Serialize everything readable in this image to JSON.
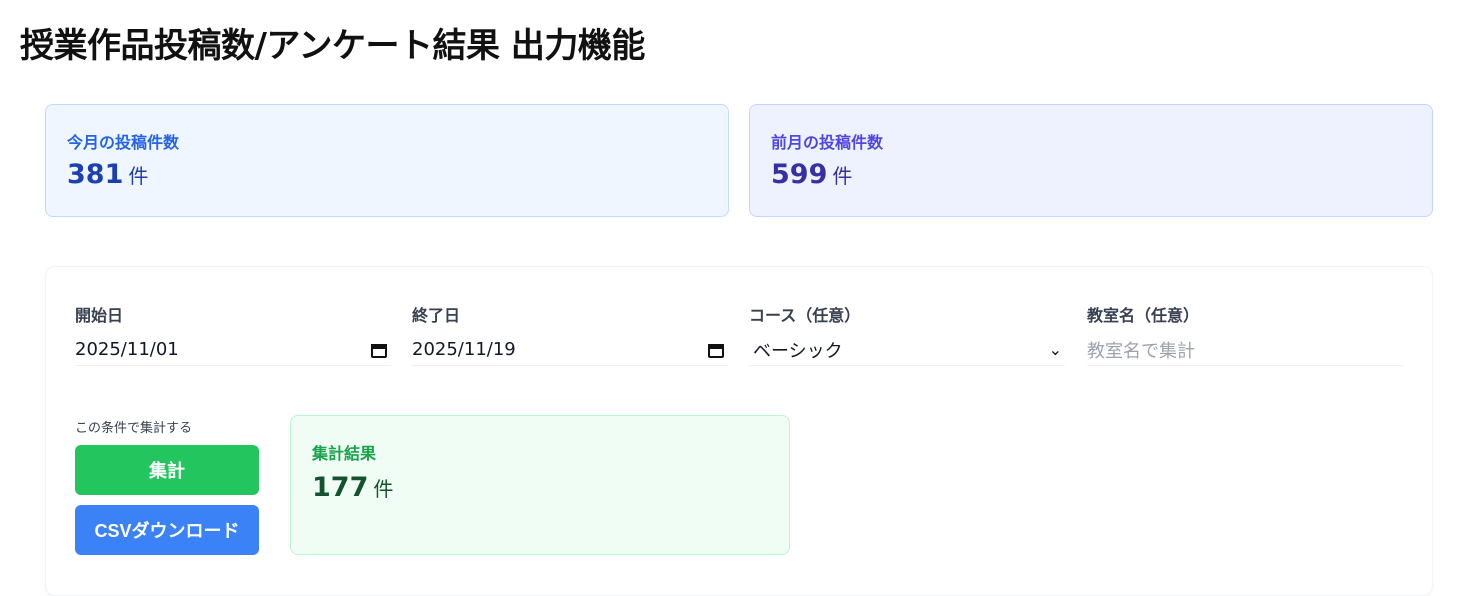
{
  "page": {
    "title": "授業作品投稿数/アンケート結果 出力機能"
  },
  "stats": {
    "current": {
      "label": "今月の投稿件数",
      "value": "381",
      "unit": "件"
    },
    "previous": {
      "label": "前月の投稿件数",
      "value": "599",
      "unit": "件"
    }
  },
  "filters": {
    "start": {
      "label": "開始日",
      "value": "2025/11/01",
      "icon": "calendar-icon"
    },
    "end": {
      "label": "終了日",
      "value": "2025/11/19",
      "icon": "calendar-icon"
    },
    "course": {
      "label": "コース（任意）",
      "value": "ベーシック",
      "icon": "chevron-down-icon"
    },
    "classroom": {
      "label": "教室名（任意）",
      "value": "",
      "placeholder": "教室名で集計"
    }
  },
  "actions": {
    "hint": "この条件で集計する",
    "aggregate_label": "集計",
    "csv_label": "CSVダウンロード"
  },
  "result": {
    "label": "集計結果",
    "value": "177",
    "unit": "件"
  },
  "colors": {
    "aggregate": "#22c55e",
    "csv": "#3b82f6",
    "result_bg": "#f0fdf4",
    "current_bg": "#eff6ff",
    "previous_bg": "#eef2ff"
  }
}
